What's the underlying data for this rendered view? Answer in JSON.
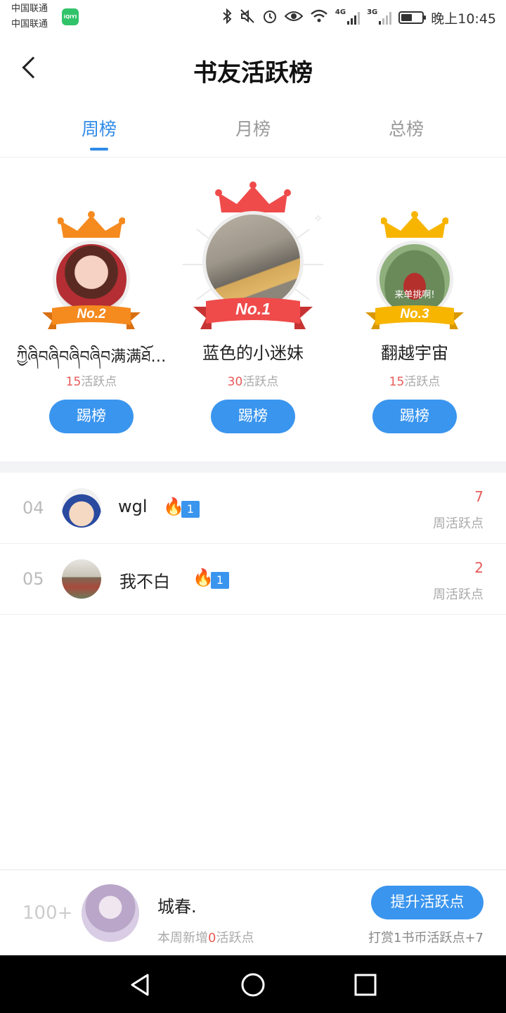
{
  "status_bar": {
    "carrier_1": "中国联通",
    "carrier_2": "中国联通",
    "app_badge": "iQIYI",
    "net_1": "4G",
    "net_2": "3G",
    "battery_level": 0.55,
    "time": "晚上10:45"
  },
  "header": {
    "title": "书友活跃榜"
  },
  "tabs": [
    {
      "label": "周榜",
      "active": true
    },
    {
      "label": "月榜",
      "active": false
    },
    {
      "label": "总榜",
      "active": false
    }
  ],
  "podium": {
    "first": {
      "rank": "No.1",
      "name": "蓝色的小迷妹",
      "points": "30",
      "points_suffix": "活跃点",
      "button": "踢榜",
      "color": "#ef4b4b"
    },
    "second": {
      "rank": "No.2",
      "name": "ཀྱིཞིབཞིབཞིབཞིབ满满ཐོ…",
      "points": "15",
      "points_suffix": "活跃点",
      "button": "踢榜",
      "color": "#f58a1f"
    },
    "third": {
      "rank": "No.3",
      "name": "翻越宇宙",
      "points": "15",
      "points_suffix": "活跃点",
      "button": "踢榜",
      "color": "#f7b500",
      "avatar_caption": "来单挑啊!"
    }
  },
  "list": [
    {
      "rank": "04",
      "name": "wgl",
      "level": "1",
      "value": "7",
      "label": "周活跃点"
    },
    {
      "rank": "05",
      "name": "我不白",
      "level": "1",
      "value": "2",
      "label": "周活跃点"
    }
  ],
  "me": {
    "rank": "100+",
    "name": "城春.",
    "sub_prefix": "本周新增",
    "sub_value": "0",
    "sub_suffix": "活跃点",
    "button": "提升活跃点",
    "reward": "打赏1书币活跃点+7"
  },
  "colors": {
    "accent": "#3a95ee",
    "highlight": "#e85a5a"
  }
}
